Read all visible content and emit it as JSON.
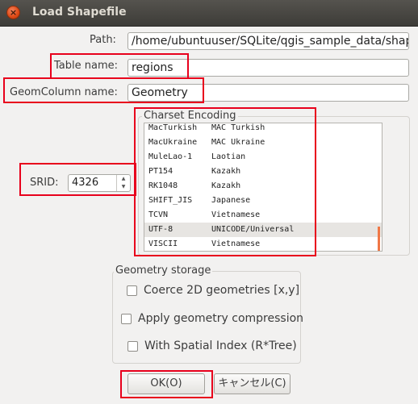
{
  "window": {
    "title": "Load Shapefile",
    "close_glyph": "×"
  },
  "form": {
    "path_label": "Path:",
    "path_value": "/home/ubuntuuser/SQLite/qgis_sample_data/shap",
    "table_name_label": "Table name:",
    "table_name_value": "regions",
    "geom_column_label": "GeomColumn name:",
    "geom_column_value": "Geometry",
    "srid_label": "SRID:",
    "srid_value": "4326"
  },
  "charset": {
    "title": "Charset Encoding",
    "items": [
      {
        "code": "MacTurkish",
        "name": "MAC Turkish"
      },
      {
        "code": "MacUkraine",
        "name": "MAC Ukraine"
      },
      {
        "code": "MuleLao-1",
        "name": "Laotian"
      },
      {
        "code": "PT154",
        "name": "Kazakh"
      },
      {
        "code": "RK1048",
        "name": "Kazakh"
      },
      {
        "code": "SHIFT_JIS",
        "name": "Japanese"
      },
      {
        "code": "TCVN",
        "name": "Vietnamese"
      },
      {
        "code": "UTF-8",
        "name": "UNICODE/Universal"
      },
      {
        "code": "VISCII",
        "name": "Vietnamese"
      }
    ],
    "selected_code": "UTF-8"
  },
  "geometry_storage": {
    "title": "Geometry storage",
    "options": [
      {
        "label": "Coerce 2D geometries [x,y]",
        "checked": false
      },
      {
        "label": "Apply geometry compression",
        "checked": false
      },
      {
        "label": "With Spatial Index (R*Tree)",
        "checked": false
      }
    ]
  },
  "buttons": {
    "ok": "OK(O)",
    "cancel": "キャンセル(C)"
  },
  "colors": {
    "highlight": "#e8001c",
    "accent": "#f07746",
    "titlebar": "#3d3c38"
  }
}
